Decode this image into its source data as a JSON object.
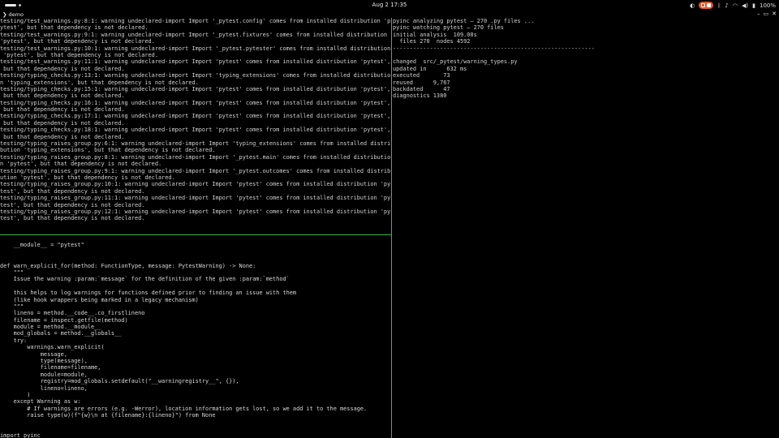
{
  "topbar": {
    "clock": "Aug 2  17:35",
    "battery": "100%"
  },
  "window": {
    "title": "demo",
    "icon": "chevron-right-icon"
  },
  "left_top_output": [
    "testing/test_warnings.py:8:1: warning undeclared-import Import '_pytest.config' comes from installed distribution 'p",
    "ytest', but that dependency is not declared.",
    "testing/test_warnings.py:9:1: warning undeclared-import Import '_pytest.fixtures' comes from installed distribution",
    "'pytest', but that dependency is not declared.",
    "testing/test_warnings.py:10:1: warning undeclared-import Import '_pytest.pytester' comes from installed distribution",
    " 'pytest', but that dependency is not declared.",
    "testing/test_warnings.py:11:1: warning undeclared-import Import 'pytest' comes from installed distribution 'pytest',",
    " but that dependency is not declared.",
    "testing/typing_checks.py:13:1: warning undeclared-import Import 'typing_extensions' comes from installed distributio",
    "n 'typing_extensions', but that dependency is not declared.",
    "testing/typing_checks.py:15:1: warning undeclared-import Import 'pytest' comes from installed distribution 'pytest',",
    " but that dependency is not declared.",
    "testing/typing_checks.py:16:1: warning undeclared-import Import 'pytest' comes from installed distribution 'pytest',",
    " but that dependency is not declared.",
    "testing/typing_checks.py:17:1: warning undeclared-import Import 'pytest' comes from installed distribution 'pytest',",
    " but that dependency is not declared.",
    "testing/typing_checks.py:18:1: warning undeclared-import Import 'pytest' comes from installed distribution 'pytest',",
    " but that dependency is not declared.",
    "testing/typing_raises_group.py:6:1: warning undeclared-import Import 'typing_extensions' comes from installed distri",
    "bution 'typing_extensions', but that dependency is not declared.",
    "testing/typing_raises_group.py:8:1: warning undeclared-import Import '_pytest.main' comes from installed distributio",
    "n 'pytest', but that dependency is not declared.",
    "testing/typing_raises_group.py:9:1: warning undeclared-import Import '_pytest.outcomes' comes from installed distrib",
    "ution 'pytest', but that dependency is not declared.",
    "testing/typing_raises_group.py:10:1: warning undeclared-import Import 'pytest' comes from installed distribution 'py",
    "test', but that dependency is not declared.",
    "testing/typing_raises_group.py:11:1: warning undeclared-import Import 'pytest' comes from installed distribution 'py",
    "test', but that dependency is not declared.",
    "testing/typing_raises_group.py:12:1: warning undeclared-import Import 'pytest' comes from installed distribution 'py",
    "test', but that dependency is not declared."
  ],
  "left_bottom_code": [
    "",
    "    __module__ = \"pytest\"",
    "",
    "",
    "def warn_explicit_for(method: FunctionType, message: PytestWarning) -> None:",
    "    \"\"\"",
    "    Issue the warning :param:`message` for the definition of the given :param:`method`",
    "",
    "    this helps to log warnings for functions defined prior to finding an issue with them",
    "    (like hook wrappers being marked in a legacy mechanism)",
    "    \"\"\"",
    "    lineno = method.__code__.co_firstlineno",
    "    filename = inspect.getfile(method)",
    "    module = method.__module__",
    "    mod_globals = method.__globals__",
    "    try:",
    "        warnings.warn_explicit(",
    "            message,",
    "            type(message),",
    "            filename=filename,",
    "            module=module,",
    "            registry=mod_globals.setdefault(\"__warningregistry__\", {}),",
    "            lineno=lineno,",
    "        )",
    "    except Warning as w:",
    "        # If warnings are errors (e.g. -Werror), location information gets lost, so we add it to the message.",
    "        raise type(w)(f\"{w}\\n at {filename}:{lineno}\") from None",
    "",
    ""
  ],
  "prompt_line": "import pyinc_",
  "right_output": [
    "pyinc analyzing pytest — 270 .py files ...",
    "pyinc watching pytest — 270 files",
    "initial analysis  109.08s",
    "  files 270  nodes 4592",
    "------------------------------------------------------------",
    "",
    "changed  src/_pytest/warning_types.py",
    "updated in      632 ms",
    "executed       73",
    "reused      9,767",
    "backdated      47",
    "diagnostics 1380"
  ]
}
